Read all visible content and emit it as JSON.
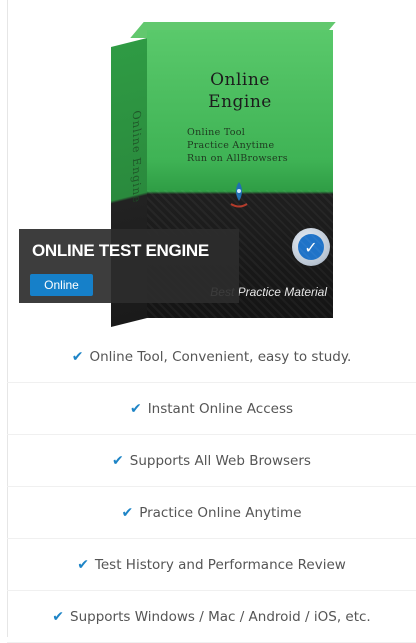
{
  "product": {
    "box_title_line1": "Online",
    "box_title_line2": "Engine",
    "box_sub_line1": "Online Tool",
    "box_sub_line2": "Practice Anytime",
    "box_sub_line3": "Run on AllBrowsers",
    "box_side_text": "Online Engine",
    "box_bottom_text": "Best Practice Material"
  },
  "overlay": {
    "title": "ONLINE TEST ENGINE",
    "badge": "Online"
  },
  "features": [
    {
      "icon": "check-icon",
      "text": "Online Tool, Convenient, easy to study."
    },
    {
      "icon": "check-icon",
      "text": "Instant Online Access"
    },
    {
      "icon": "check-icon",
      "text": "Supports All Web Browsers"
    },
    {
      "icon": "check-icon",
      "text": "Practice Online Anytime"
    },
    {
      "icon": "check-icon",
      "text": "Test History and Performance Review"
    },
    {
      "icon": "check-icon",
      "text": "Supports Windows / Mac / Android / iOS, etc."
    }
  ],
  "colors": {
    "accent": "#1d84c6",
    "badge": "#1680c9",
    "box_green": "#3fb355",
    "overlay": "#2d2d2d"
  }
}
